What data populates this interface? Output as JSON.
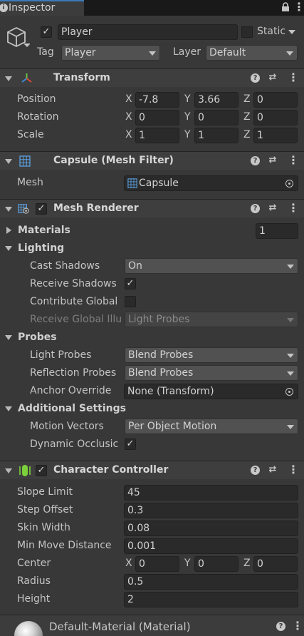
{
  "tab": {
    "title": "Inspector",
    "lock_icon": "lock-icon",
    "menu_icon": "kebab-menu-icon"
  },
  "object": {
    "name": "Player",
    "active": true,
    "static_label": "Static",
    "static": false,
    "tag_label": "Tag",
    "tag": "Player",
    "layer_label": "Layer",
    "layer": "Default"
  },
  "transform": {
    "title": "Transform",
    "rows": [
      {
        "label": "Position",
        "x": "-7.8",
        "y": "3.66",
        "z": "0"
      },
      {
        "label": "Rotation",
        "x": "0",
        "y": "0",
        "z": "0"
      },
      {
        "label": "Scale",
        "x": "1",
        "y": "1",
        "z": "1"
      }
    ],
    "axis": {
      "x": "X",
      "y": "Y",
      "z": "Z"
    }
  },
  "mesh_filter": {
    "title": "Capsule (Mesh Filter)",
    "mesh_label": "Mesh",
    "mesh": "Capsule"
  },
  "mesh_renderer": {
    "title": "Mesh Renderer",
    "enabled": true,
    "materials_label": "Materials",
    "materials_count": "1",
    "lighting_label": "Lighting",
    "cast_shadows_label": "Cast Shadows",
    "cast_shadows": "On",
    "receive_shadows_label": "Receive Shadows",
    "receive_shadows": true,
    "contribute_gi_label": "Contribute Global",
    "contribute_gi": false,
    "receive_gi_label": "Receive Global Illu",
    "receive_gi": "Light Probes",
    "probes_label": "Probes",
    "light_probes_label": "Light Probes",
    "light_probes": "Blend Probes",
    "reflection_probes_label": "Reflection Probes",
    "reflection_probes": "Blend Probes",
    "anchor_override_label": "Anchor Override",
    "anchor_override": "None (Transform)",
    "additional_label": "Additional Settings",
    "motion_vectors_label": "Motion Vectors",
    "motion_vectors": "Per Object Motion",
    "dynamic_occlusion_label": "Dynamic Occlusic",
    "dynamic_occlusion": true
  },
  "character_controller": {
    "title": "Character Controller",
    "enabled": true,
    "slope_limit_label": "Slope Limit",
    "slope_limit": "45",
    "step_offset_label": "Step Offset",
    "step_offset": "0.3",
    "skin_width_label": "Skin Width",
    "skin_width": "0.08",
    "min_move_label": "Min Move Distance",
    "min_move": "0.001",
    "center_label": "Center",
    "center": {
      "x": "0",
      "y": "0",
      "z": "0"
    },
    "radius_label": "Radius",
    "radius": "0.5",
    "height_label": "Height",
    "height": "2"
  },
  "material": {
    "title": "Default-Material (Material)"
  },
  "colors": {
    "background": "#383838",
    "header": "#3e3e3e",
    "field": "#2a2a2a",
    "accent": "#3a79bb"
  }
}
